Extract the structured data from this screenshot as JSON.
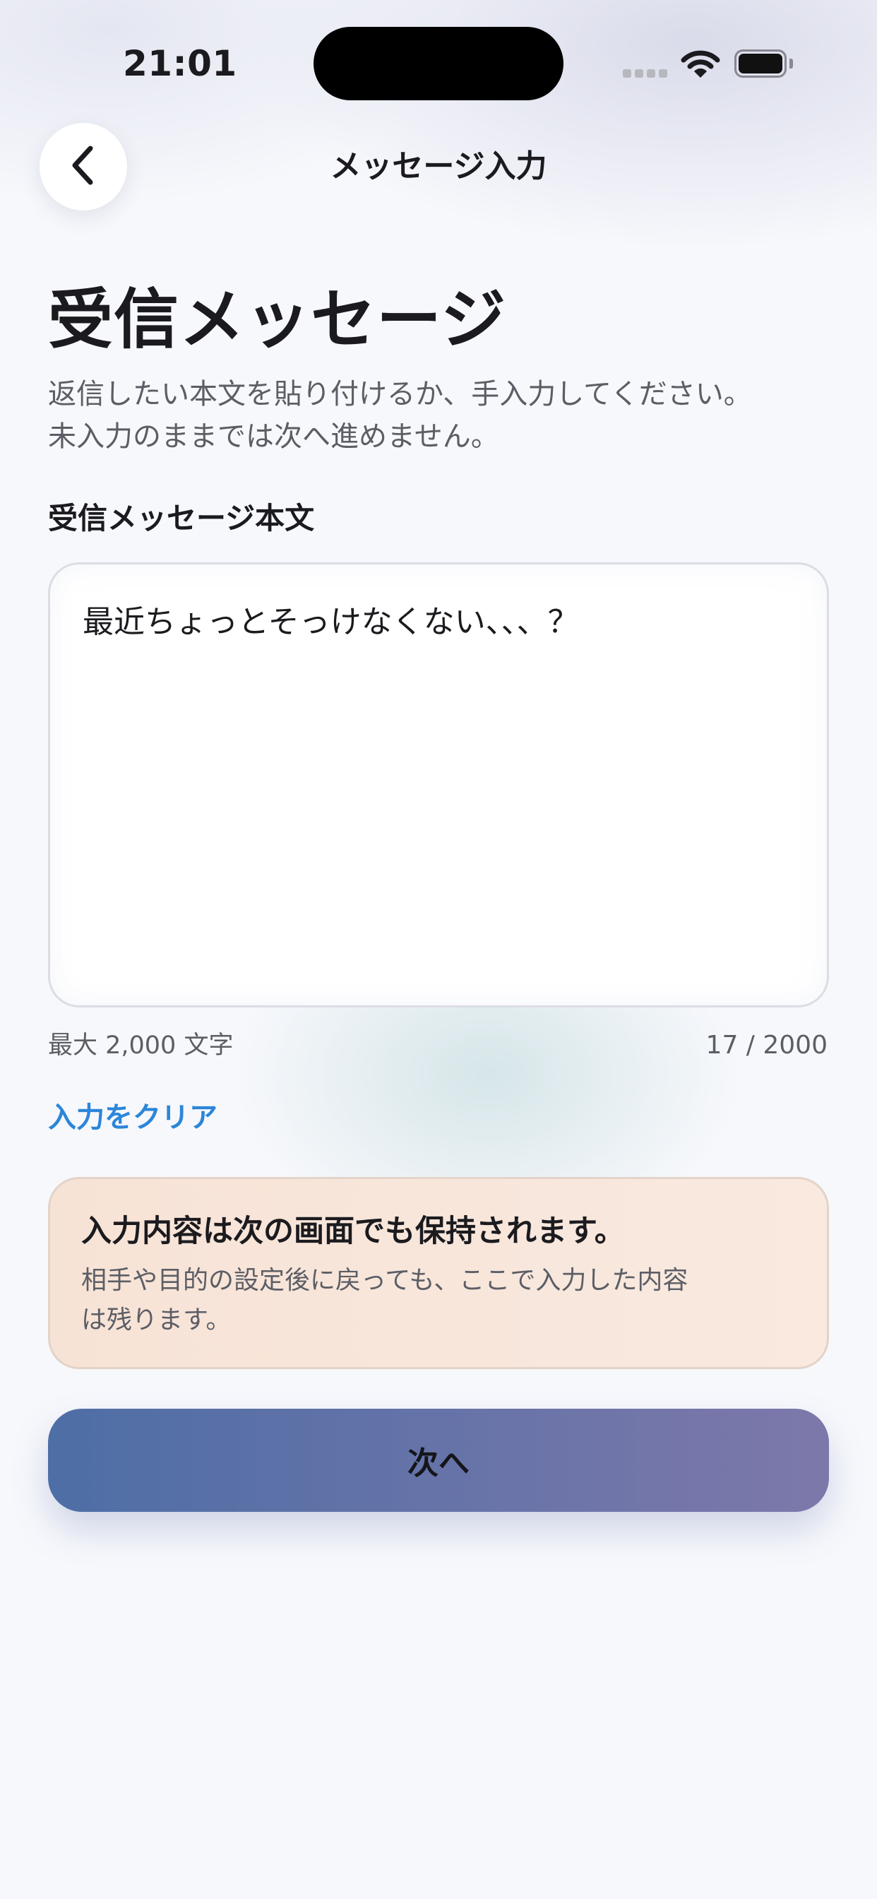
{
  "status_bar": {
    "time": "21:01"
  },
  "nav": {
    "title": "メッセージ入力",
    "back_icon": "chevron-left-icon"
  },
  "header": {
    "title": "受信メッセージ",
    "description_lines": [
      "返信したい本文を貼り付けるか、手入力してください。",
      "未入力のままでは次へ進めません。"
    ]
  },
  "input": {
    "label": "受信メッセージ本文",
    "value": "最近ちょっとそっけなくない、、、？",
    "max_hint": "最大 2,000 文字",
    "counter": "17 / 2000",
    "clear_label": "入力をクリア"
  },
  "info": {
    "title": "入力内容は次の画面でも保持されます。",
    "body_lines": [
      "相手や目的の設定後に戻っても、ここで入力した内容",
      "は残ります。"
    ]
  },
  "actions": {
    "next_label": "次へ"
  },
  "colors": {
    "accent_link": "#2b86d9",
    "button_gradient_start": "#4e6ea6",
    "button_gradient_end": "#7d78aa",
    "info_card_bg": "#f7e3d6"
  }
}
